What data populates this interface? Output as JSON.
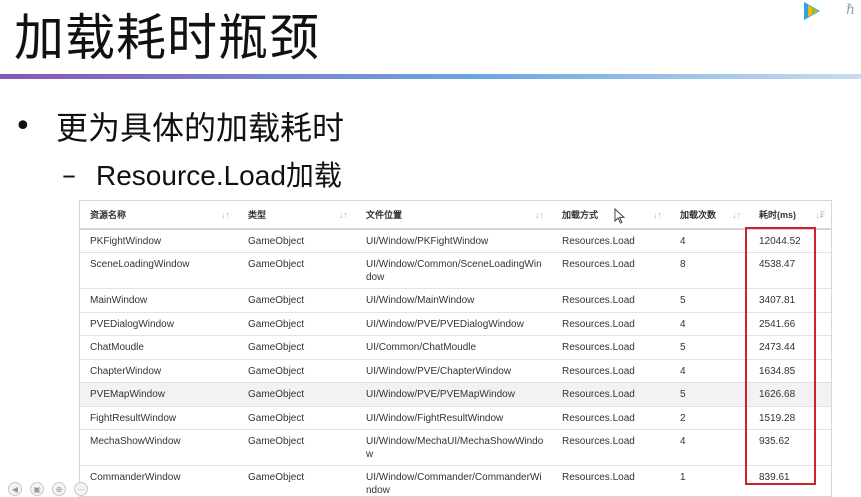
{
  "slide": {
    "title": "加载耗时瓶颈",
    "bullet": "更为具体的加载耗时",
    "sub_bullet": "Resource.Load加载"
  },
  "table": {
    "columns": [
      {
        "label": "资源名称",
        "sort_icon": "↓↑"
      },
      {
        "label": "类型",
        "sort_icon": "↓↑"
      },
      {
        "label": "文件位置",
        "sort_icon": "↓↑"
      },
      {
        "label": "加载方式",
        "sort_icon": "↓↑"
      },
      {
        "label": "加载次数",
        "sort_icon": "↓↑"
      },
      {
        "label": "耗时(ms)",
        "sort_icon": "↓₣"
      }
    ],
    "rows": [
      {
        "name": "PKFightWindow",
        "type": "GameObject",
        "path": "UI/Window/PKFightWindow",
        "method": "Resources.Load",
        "count": "4",
        "time": "12044.52"
      },
      {
        "name": "SceneLoadingWindow",
        "type": "GameObject",
        "path": "UI/Window/Common/SceneLoadingWindow",
        "method": "Resources.Load",
        "count": "8",
        "time": "4538.47"
      },
      {
        "name": "MainWindow",
        "type": "GameObject",
        "path": "UI/Window/MainWindow",
        "method": "Resources.Load",
        "count": "5",
        "time": "3407.81"
      },
      {
        "name": "PVEDialogWindow",
        "type": "GameObject",
        "path": "UI/Window/PVE/PVEDialogWindow",
        "method": "Resources.Load",
        "count": "4",
        "time": "2541.66"
      },
      {
        "name": "ChatMoudle",
        "type": "GameObject",
        "path": "UI/Common/ChatMoudle",
        "method": "Resources.Load",
        "count": "5",
        "time": "2473.44"
      },
      {
        "name": "ChapterWindow",
        "type": "GameObject",
        "path": "UI/Window/PVE/ChapterWindow",
        "method": "Resources.Load",
        "count": "4",
        "time": "1634.85"
      },
      {
        "name": "PVEMapWindow",
        "type": "GameObject",
        "path": "UI/Window/PVE/PVEMapWindow",
        "method": "Resources.Load",
        "count": "5",
        "time": "1626.68"
      },
      {
        "name": "FightResultWindow",
        "type": "GameObject",
        "path": "UI/Window/FightResultWindow",
        "method": "Resources.Load",
        "count": "2",
        "time": "1519.28"
      },
      {
        "name": "MechaShowWindow",
        "type": "GameObject",
        "path": "UI/Window/MechaUI/MechaShowWindow",
        "method": "Resources.Load",
        "count": "4",
        "time": "935.62"
      },
      {
        "name": "CommanderWindow",
        "type": "GameObject",
        "path": "UI/Window/Commander/CommanderWindow",
        "method": "Resources.Load",
        "count": "1",
        "time": "839.61"
      }
    ]
  },
  "colors": {
    "highlight": "#d0202a",
    "title_rule_start": "#8a56b8",
    "title_rule_end": "#6aa6e0"
  },
  "icons": {
    "logo": "tencent-video-logo",
    "cursor": "mouse-cursor-icon",
    "toolbar": [
      "back-icon",
      "copy-icon",
      "zoom-icon",
      "more-icon"
    ]
  }
}
